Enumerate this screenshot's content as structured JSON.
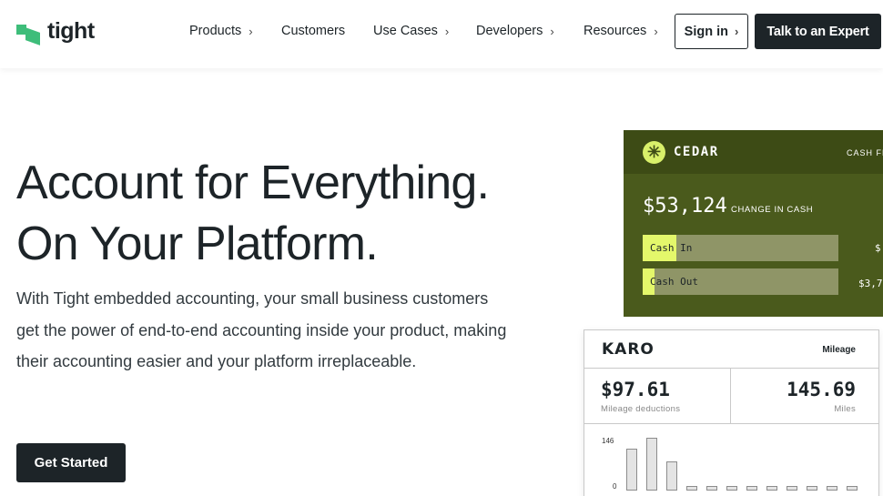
{
  "nav": {
    "brand": "tight",
    "links": [
      {
        "label": "Products",
        "chevron": "›"
      },
      {
        "label": "Customers",
        "chevron": ""
      },
      {
        "label": "Use Cases",
        "chevron": "›"
      },
      {
        "label": "Developers",
        "chevron": "›"
      },
      {
        "label": "Resources",
        "chevron": "›"
      }
    ],
    "signin_label": "Sign in",
    "signin_chevron": "›",
    "expert_label": "Talk to an Expert"
  },
  "hero": {
    "title_line1": "Account for Everything.",
    "title_line2": "On Your Platform.",
    "subtitle": "With Tight embedded accounting, your small business customers get the power of end-to-end accounting inside your product, making their accounting easier and your platform irreplaceable.",
    "cta_label": "Get Started"
  },
  "cedar": {
    "icon": "✳",
    "name": "CEDAR",
    "tag": "CASH FLO",
    "amount": "$53,124",
    "amount_label": "CHANGE IN CASH",
    "rows": [
      {
        "label": "Cash In",
        "value": "$",
        "fill_fraction": 0.17
      },
      {
        "label": "Cash Out",
        "value": "$3,7",
        "fill_fraction": 0.06
      }
    ]
  },
  "karo": {
    "logo": "KARO",
    "tab": "Mileage",
    "stat_left_value": "$97.61",
    "stat_left_label": "Mileage deductions",
    "stat_right_value": "145.69",
    "stat_right_label": "Miles",
    "chart_y_max": "146",
    "chart_y_min": "0",
    "bars": [
      80,
      100,
      55,
      6,
      6,
      6,
      6,
      6,
      6,
      6,
      6,
      6
    ]
  },
  "colors": {
    "brand_green": "#3ebd7a",
    "dark": "#1d2428",
    "cedar_bg": "#4a5a1c",
    "cedar_accent": "#e4f76b"
  }
}
